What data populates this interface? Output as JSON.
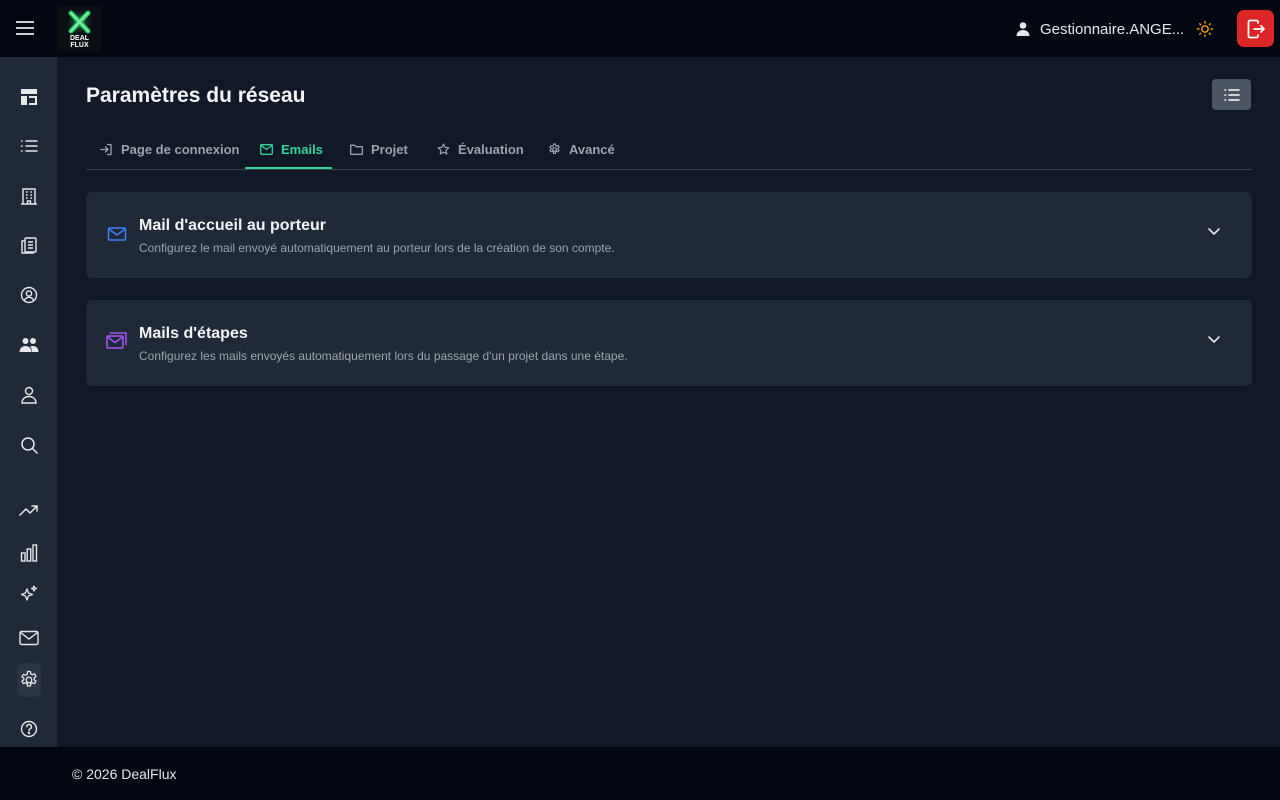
{
  "topbar": {
    "logo_line1": "DEAL",
    "logo_line2": "FLUX",
    "user_name": "Gestionnaire.ANGE..."
  },
  "page": {
    "title": "Paramètres du réseau"
  },
  "tabs": [
    {
      "label": "Page de connexion",
      "icon": "login-icon"
    },
    {
      "label": "Emails",
      "icon": "mail-icon",
      "active": true
    },
    {
      "label": "Projet",
      "icon": "folder-icon"
    },
    {
      "label": "Évaluation",
      "icon": "star-icon"
    },
    {
      "label": "Avancé",
      "icon": "gear-icon"
    }
  ],
  "cards": [
    {
      "title": "Mail d'accueil au porteur",
      "description": "Configurez le mail envoyé automatiquement au porteur lors de la création de son compte.",
      "icon": "envelope-icon",
      "icon_color": "#3b82f6"
    },
    {
      "title": "Mails d'étapes",
      "description": "Configurez les mails envoyés automatiquement lors du passage d'un projet dans une étape.",
      "icon": "envelopes-stack-icon",
      "icon_color": "#a855f7"
    }
  ],
  "sidebar": {
    "items": [
      "dashboard-icon",
      "list-icon",
      "building-icon",
      "clipboard-icon",
      "user-circle-icon",
      "users-icon",
      "user-icon",
      "search-icon",
      "trending-icon",
      "bar-chart-icon",
      "sparkles-icon",
      "mail-icon",
      "settings-icon",
      "help-icon"
    ],
    "active": "settings-icon"
  },
  "footer": {
    "text": "©  2026 DealFlux"
  },
  "colors": {
    "accent": "#34d399",
    "logout": "#dc2626",
    "sun": "#f59e0b"
  }
}
